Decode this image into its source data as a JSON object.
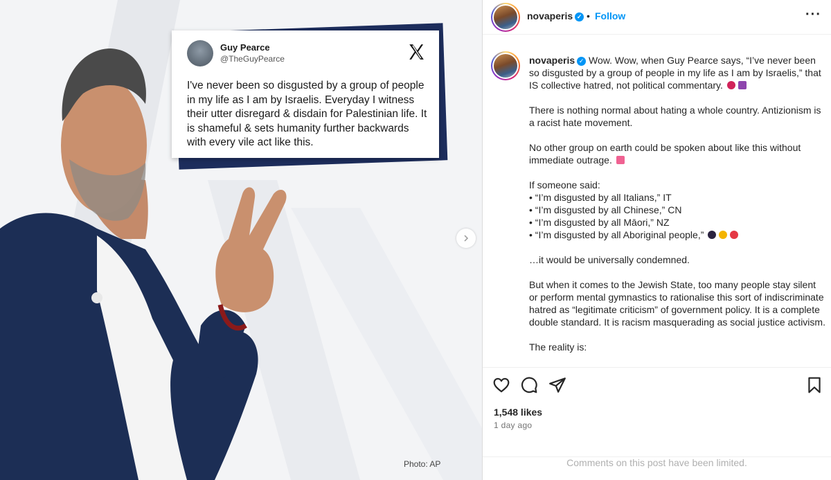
{
  "media": {
    "tweet": {
      "name": "Guy Pearce",
      "handle": "@TheGuyPearce",
      "text": "I've never been so disgusted by a group of people in my life as I am by Israelis. Everyday I witness their utter disregard & disdain for Palestinian life. It is shameful & sets humanity further backwards with every vile act like this."
    },
    "photo_credit": "Photo: AP",
    "next_icon": "chevron-right-icon"
  },
  "header": {
    "username": "novaperis",
    "separator": "•",
    "follow_label": "Follow",
    "more_label": "···"
  },
  "caption": {
    "username": "novaperis",
    "paragraphs": [
      "Wow. Wow, when Guy Pearce says, “I’ve never been so disgusted by a group of people in my life as I am by Israelis,” that IS collective hatred, not political commentary.",
      "There is nothing normal about hating a whole country. Antizionism is a racist hate movement.",
      "No other group on earth could be spoken about like this without immediate outrage.",
      "If someone said:",
      "• “I’m disgusted by all Italians,” IT",
      "• “I’m disgusted by all Chinese,” CN",
      "• “I’m disgusted by all Māori,” NZ",
      "• “I’m disgusted by all Aboriginal people,”",
      "…it would be universally condemned.",
      "But when it comes to the Jewish State, too many people stay silent or perform mental gymnastics to rationalise this sort of indiscriminate hatred as “legitimate criticism” of government policy. It is a complete double standard. It is racism masquerading as social justice activism.",
      "The reality is:"
    ]
  },
  "footer": {
    "likes": "1,548 likes",
    "time": "1 day ago",
    "comments_limited": "Comments on this post have been limited."
  },
  "colors": {
    "accent": "#0095f6",
    "navy": "#1d2d5c"
  }
}
